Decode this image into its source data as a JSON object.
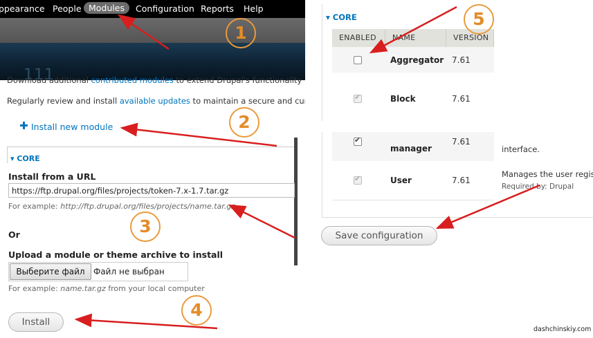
{
  "toolbar": {
    "items": [
      "ppearance",
      "People",
      "Modules",
      "Configuration",
      "Reports",
      "Help"
    ],
    "active": "Modules"
  },
  "header": {
    "number": "111"
  },
  "intro": {
    "line1_prefix": "Download additional ",
    "line1_link": "contributed modules",
    "line1_suffix": " to extend Drupal's functionality",
    "line2_prefix": "Regularly review and install ",
    "line2_link": "available updates",
    "line2_suffix": " to maintain a secure and cur"
  },
  "install_link": "Install new module",
  "core_label": "CORE",
  "url_section": {
    "label": "Install from a URL",
    "value": "https://ftp.drupal.org/files/projects/token-7.x-1.7.tar.gz",
    "hint_prefix": "For example: ",
    "hint_example": "http://ftp.drupal.org/files/projects/name.tar.gz"
  },
  "or_label": "Or",
  "upload_section": {
    "label": "Upload a module or theme archive to install",
    "button": "Выберите файл",
    "status": "Файл не выбран",
    "hint_prefix": "For example: ",
    "hint_example": "name.tar.gz",
    "hint_suffix": " from your local computer"
  },
  "install_button": "Install",
  "modules_table": {
    "headers": [
      "ENABLED",
      "NAME",
      "VERSION"
    ],
    "rows": [
      {
        "name": "Aggregator",
        "version": "7.61",
        "checked": false,
        "disabled": false,
        "description": ""
      },
      {
        "name": "Block",
        "version": "7.61",
        "checked": true,
        "disabled": true,
        "description": ""
      },
      {
        "name": "manager",
        "version": "7.61",
        "checked": true,
        "disabled": false,
        "description": "interface."
      },
      {
        "name": "User",
        "version": "7.61",
        "checked": true,
        "disabled": true,
        "description": "Manages the user regis",
        "required_by": "Required by: Drupal"
      }
    ]
  },
  "save_button": "Save configuration",
  "steps": [
    "1",
    "2",
    "3",
    "4",
    "5"
  ],
  "watermark": "dashchinskiy.com",
  "colors": {
    "link": "#0074bd",
    "annotation": "#e48c28",
    "arrow": "#d81e1e"
  }
}
